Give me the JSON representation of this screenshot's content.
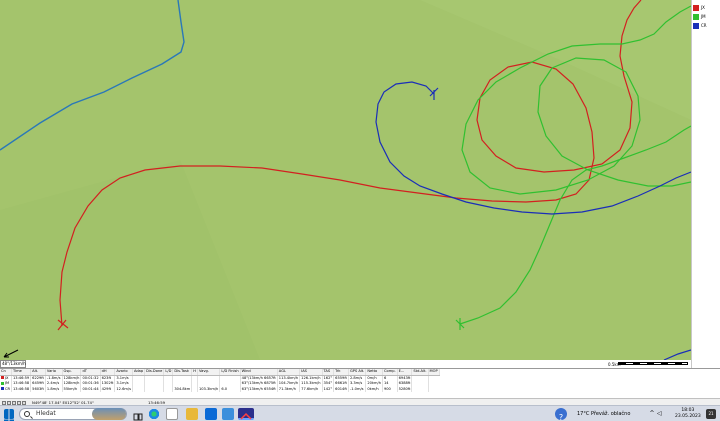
{
  "legend": [
    {
      "label": "JX",
      "color": "#d22020"
    },
    {
      "label": "JM",
      "color": "#30c030"
    },
    {
      "label": "CR",
      "color": "#1a2eb8"
    }
  ],
  "map": {
    "background": "#a4c46c",
    "wind_readout": "48°/13km/h",
    "scale_label": "0.5km",
    "colors": {
      "airspace": "#2a78b8"
    }
  },
  "grid": {
    "headers": [
      "Cn",
      "Time",
      "Alt.",
      "Vario",
      "Gsp.",
      "dT",
      "dH",
      "Avario",
      "Adap",
      "Dis.Done",
      "L/D",
      "Dis.Task",
      "H",
      "Vavg.",
      "L/D Finish",
      "Wind",
      "AGL",
      "IAS",
      "TAS",
      "Trk",
      "GPS Alt.",
      "Netto",
      "Comp.",
      "E...",
      "Std.Alt.",
      "MOP"
    ],
    "rows": [
      {
        "color": "#d22020",
        "cells": [
          "JX",
          "13:46:59",
          "6229ft",
          "-1.8m/s",
          "128km/h",
          "00:01:32",
          "623ft",
          "3.1m/s",
          "",
          "",
          "",
          "",
          "",
          "",
          "",
          "48°/13km/h 6657ft",
          "113.4km/h",
          "126.1km/h",
          "162°",
          "6559ft",
          "2.8m/s",
          "0m/h",
          "6",
          "6943ft",
          ""
        ]
      },
      {
        "color": "#30c030",
        "cells": [
          "JM",
          "13:46:58",
          "6459ft",
          "2.4m/s",
          "128km/h",
          "00:01:36",
          "1302ft",
          "3.1m/s",
          "",
          "",
          "",
          "",
          "",
          "",
          "",
          "63°/13km/h 6875ft",
          "104.7km/h",
          "115.3km/h",
          "354°",
          "6661ft",
          "3.3m/s",
          "20km/h",
          "14",
          "6388ft",
          ""
        ]
      },
      {
        "color": "#1a2eb8",
        "cells": [
          "CR",
          "13:46:58",
          "5603ft",
          "1.8m/s",
          "55km/h",
          "00:01:44",
          "429ft",
          "12.6m/s",
          "",
          "",
          "",
          "304.8km",
          "",
          "103.3km/h",
          "6.0",
          "63°/13km/h 6554ft",
          "71.3km/h",
          "77.6km/h",
          "142°",
          "6014ft",
          "-1.0m/s",
          "0km/h",
          "900",
          "5280ft",
          ""
        ]
      }
    ]
  },
  "timebar": {
    "buttons": [
      "◄",
      "|◄",
      "►",
      "►|",
      "■"
    ],
    "coords": "N49°48' 17.04\"  E012°52' 01.74\"",
    "time": "13:46:59"
  },
  "taskbar": {
    "search_placeholder": "Hledat",
    "weather": "17°C  Převáž. oblačno",
    "time": "18:03",
    "date": "23.05.2023",
    "notification_count": "21"
  }
}
